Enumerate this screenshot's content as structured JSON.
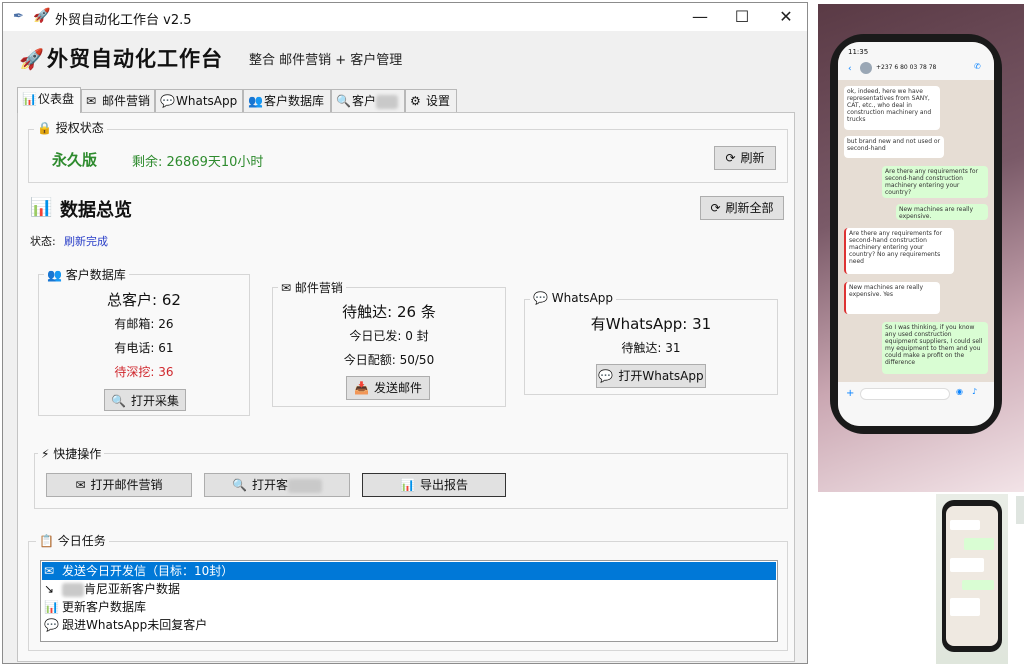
{
  "window": {
    "title": "外贸自动化工作台 v2.5",
    "controls": {
      "minimize": "—",
      "maximize": "☐",
      "close": "✕"
    }
  },
  "header": {
    "title": "外贸自动化工作台",
    "subtitle": "整合 邮件营销 + 客户管理"
  },
  "tabs": [
    {
      "icon": "📊",
      "label": "仪表盘"
    },
    {
      "icon": "✉",
      "label": "邮件营销"
    },
    {
      "icon": "💬",
      "label": "WhatsApp"
    },
    {
      "icon": "👥",
      "label": "客户数据库"
    },
    {
      "icon": "🔍",
      "label": "客户"
    },
    {
      "icon": "⚙",
      "label": "设置"
    }
  ],
  "license": {
    "group_label": "授权状态",
    "edition": "永久版",
    "remaining": "剩余: 26869天10小时",
    "refresh_label": "刷新"
  },
  "overview": {
    "title": "数据总览",
    "refresh_all_label": "刷新全部",
    "status_label": "状态:",
    "status_value": "刷新完成"
  },
  "customer_db": {
    "group_label": "客户数据库",
    "total": "总客户: 62",
    "with_email": "有邮箱: 26",
    "with_phone": "有电话: 61",
    "to_mine": "待深挖: 36",
    "open_label": "打开采集"
  },
  "email": {
    "group_label": "邮件营销",
    "pending": "待触达: 26 条",
    "sent_today": "今日已发: 0 封",
    "quota_today": "今日配额: 50/50",
    "send_label": "发送邮件"
  },
  "whatsapp": {
    "group_label": "WhatsApp",
    "has_whatsapp": "有WhatsApp: 31",
    "pending": "待触达: 31",
    "open_label": "打开WhatsApp"
  },
  "quick_actions": {
    "group_label": "快捷操作",
    "open_email": "打开邮件营销",
    "open_customer": "打开客",
    "export_report": "导出报告"
  },
  "tasks": {
    "group_label": "今日任务",
    "items": [
      {
        "icon": "✉",
        "text": "发送今日开发信（目标：10封）"
      },
      {
        "icon": "↘",
        "text": "肯尼亚新客户数据"
      },
      {
        "icon": "📊",
        "text": "更新客户数据库"
      },
      {
        "icon": "💬",
        "text": "跟进WhatsApp未回复客户"
      }
    ]
  },
  "photo": {
    "time": "11:35",
    "contact": "+237 6 80 03 78 78",
    "messages": [
      {
        "side": "in",
        "text": "ok, indeed, here we have representatives from SANY, CAT, etc., who deal in construction machinery and trucks"
      },
      {
        "side": "in",
        "text": "but brand new and not used or second-hand"
      },
      {
        "side": "out",
        "text": "Are there any requirements for second-hand construction machinery entering your country?"
      },
      {
        "side": "out",
        "text": "New machines are really expensive."
      },
      {
        "side": "in",
        "text": "Are there any requirements for second-hand construction machinery entering your country? No any requirements need"
      },
      {
        "side": "in",
        "text": "New machines are really expensive. Yes"
      },
      {
        "side": "out",
        "text": "So I was thinking, if you know any used construction equipment suppliers, I could sell my equipment to them and you could make a profit on the difference"
      }
    ]
  }
}
